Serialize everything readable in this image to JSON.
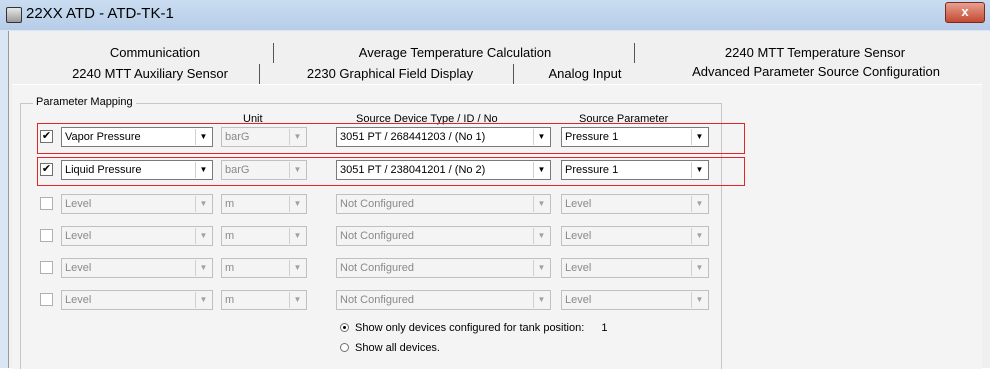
{
  "window": {
    "title": "22XX ATD  - ATD-TK-1",
    "close_label": "x"
  },
  "tabs_row1": [
    {
      "label": "Communication"
    },
    {
      "label": "Average Temperature Calculation"
    },
    {
      "label": "2240 MTT Temperature Sensor"
    }
  ],
  "tabs_row2": [
    {
      "label": "2240 MTT Auxiliary Sensor"
    },
    {
      "label": "2230 Graphical Field Display"
    },
    {
      "label": "Analog Input"
    },
    {
      "label": "Advanced Parameter Source Configuration",
      "active": true
    }
  ],
  "group": {
    "label": "Parameter Mapping",
    "headers": {
      "unit": "Unit",
      "source": "Source Device Type / ID / No",
      "param": "Source Parameter"
    }
  },
  "rows": [
    {
      "checked": "✔",
      "parameter": "Vapor Pressure",
      "unit": "barG",
      "source": "3051  PT  / 268441203 / (No 1)",
      "source_param": "Pressure 1",
      "enabled": true
    },
    {
      "checked": "✔",
      "parameter": "Liquid Pressure",
      "unit": "barG",
      "source": "3051  PT  / 238041201 / (No 2)",
      "source_param": "Pressure 1",
      "enabled": true
    },
    {
      "checked": "",
      "parameter": "Level",
      "unit": "m",
      "source": "Not Configured",
      "source_param": "Level",
      "enabled": false
    },
    {
      "checked": "",
      "parameter": "Level",
      "unit": "m",
      "source": "Not Configured",
      "source_param": "Level",
      "enabled": false
    },
    {
      "checked": "",
      "parameter": "Level",
      "unit": "m",
      "source": "Not Configured",
      "source_param": "Level",
      "enabled": false
    },
    {
      "checked": "",
      "parameter": "Level",
      "unit": "m",
      "source": "Not Configured",
      "source_param": "Level",
      "enabled": false
    }
  ],
  "options": {
    "show_configured": "Show only devices configured for tank position:",
    "tank_position": "1",
    "show_all": "Show all devices."
  }
}
